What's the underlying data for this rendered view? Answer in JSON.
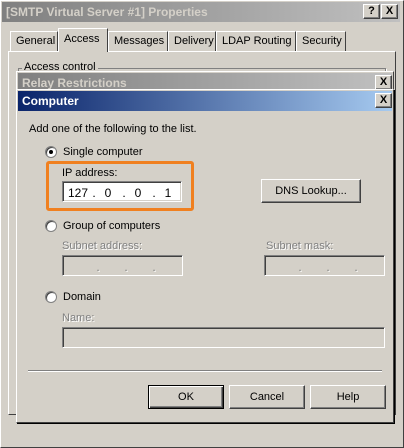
{
  "outer_window": {
    "title": "[SMTP Virtual Server #1] Properties",
    "help_btn": "?",
    "close_btn": "X",
    "tabs": [
      {
        "label": "General"
      },
      {
        "label": "Access"
      },
      {
        "label": "Messages"
      },
      {
        "label": "Delivery"
      },
      {
        "label": "LDAP Routing"
      },
      {
        "label": "Security"
      }
    ],
    "active_tab": "Access",
    "groupbox_label": "Access control"
  },
  "relay_window": {
    "title": "Relay Restrictions",
    "close_btn": "X"
  },
  "dialog": {
    "title": "Computer",
    "close_btn": "X",
    "instruction": "Add one of the following to the list.",
    "single_computer": {
      "label": "Single computer",
      "selected": true,
      "ip_label": "IP address:",
      "ip_octets": [
        "127",
        "0",
        "0",
        "1"
      ],
      "dot": "."
    },
    "dns_lookup_label": "DNS Lookup...",
    "group": {
      "label": "Group of computers",
      "selected": false,
      "subnet_address_label": "Subnet address:",
      "subnet_mask_label": "Subnet mask:"
    },
    "domain": {
      "label": "Domain",
      "selected": false,
      "name_label": "Name:"
    },
    "buttons": {
      "ok": "OK",
      "cancel": "Cancel",
      "help": "Help"
    }
  },
  "colors": {
    "active_title_start": "#0a246a",
    "active_title_end": "#a6caf0",
    "inactive_title_start": "#808080",
    "highlight": "#f08020",
    "face": "#d4d0c8"
  }
}
